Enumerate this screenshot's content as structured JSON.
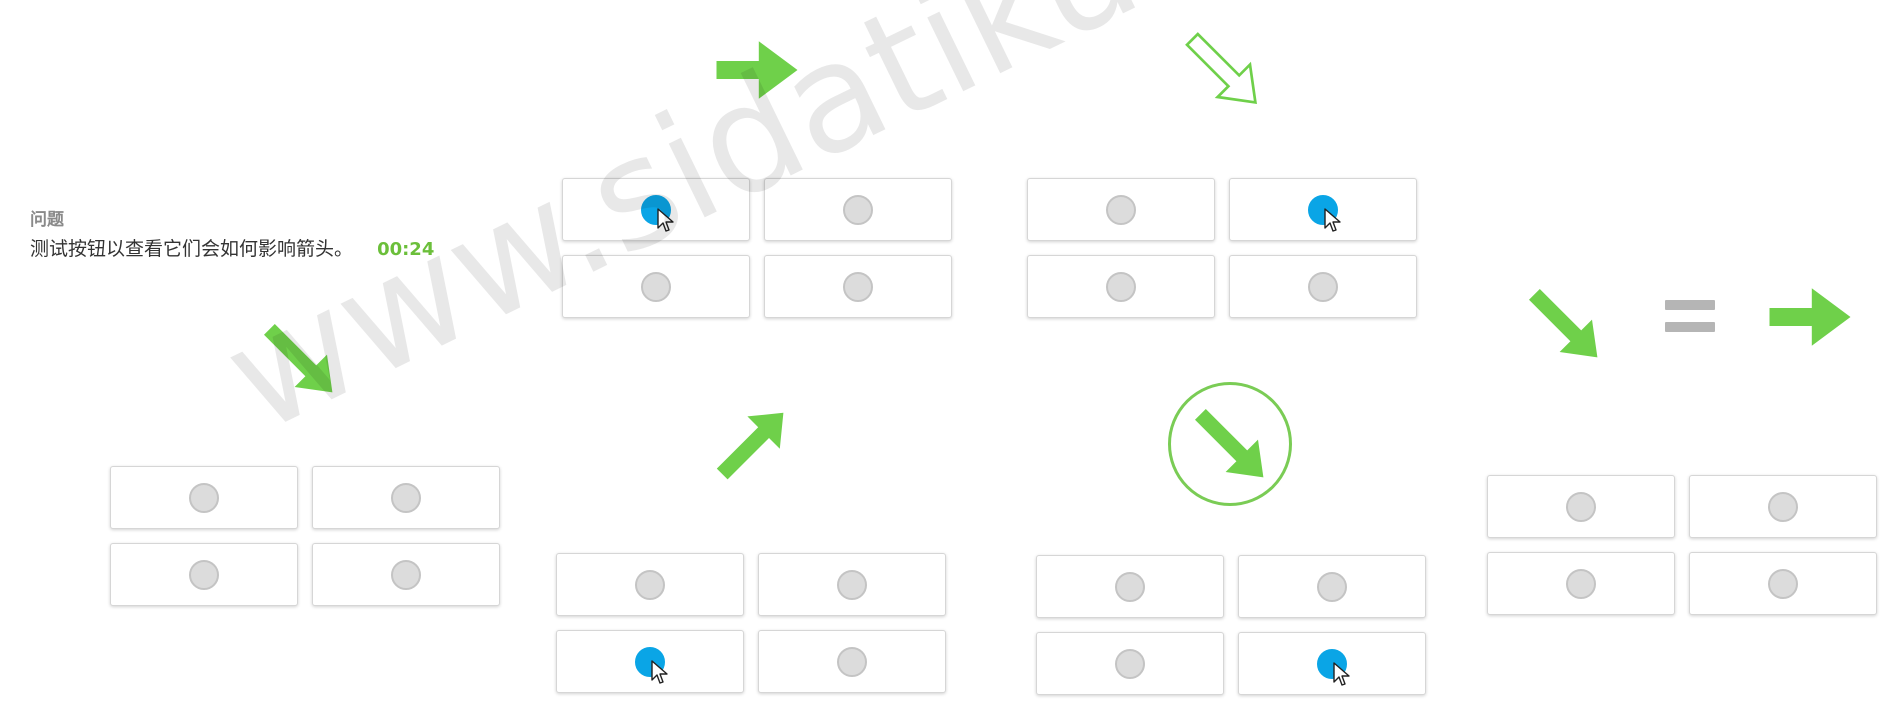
{
  "question": {
    "label": "问题",
    "text": "测试按钮以查看它们会如何影响箭头。",
    "timer": "00:24"
  },
  "watermark": "www.sidatiku.com",
  "colors": {
    "arrow_green": "#6fd04a",
    "knob_active": "#0aa5e6",
    "knob_inactive": "#dcdcdc",
    "equals_gray": "#b5b5b5"
  },
  "panels": [
    {
      "id": "panel-1",
      "arrow": "arrow-down-right",
      "buttons": [
        false,
        false,
        false,
        false
      ]
    },
    {
      "id": "panel-2",
      "arrow": "arrow-right",
      "buttons": [
        true,
        false,
        false,
        false
      ]
    },
    {
      "id": "panel-3",
      "arrow": "arrow-up-right",
      "buttons": [
        false,
        false,
        true,
        false
      ]
    },
    {
      "id": "panel-4",
      "arrow": "outline-arrow-down-right",
      "buttons": [
        false,
        true,
        false,
        false
      ]
    },
    {
      "id": "panel-5",
      "arrow": "circled-arrow-down-right",
      "buttons": [
        false,
        false,
        false,
        true
      ]
    },
    {
      "id": "panel-6",
      "arrow_left": "arrow-down-right",
      "operator": "equals",
      "arrow_right": "arrow-right",
      "buttons": [
        false,
        false,
        false,
        false
      ]
    }
  ]
}
